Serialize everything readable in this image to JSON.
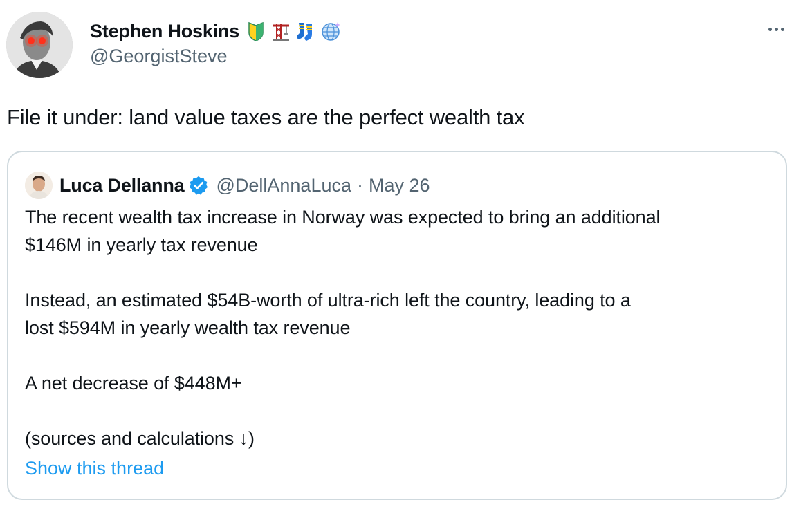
{
  "author": {
    "name": "Stephen Hoskins",
    "handle": "@GeorgistSteve",
    "name_emojis": [
      "beginner-shield-emoji",
      "construction-crane-emoji",
      "socks-emoji",
      "globe-emoji"
    ]
  },
  "tweet": {
    "text": "File it under: land value taxes are the perfect wealth tax"
  },
  "quoted": {
    "name": "Luca Dellanna",
    "handle": "@DellAnnaLuca",
    "separator": "·",
    "date": "May 26",
    "verified_color": "#1d9bf0",
    "paragraphs": [
      "The recent wealth tax increase in Norway was expected to bring an additional",
      "$146M in yearly tax revenue",
      "",
      "Instead, an estimated $54B-worth of ultra-rich left the country, leading to a",
      "lost $594M in yearly wealth tax revenue",
      "",
      "A net decrease of $448M+",
      "",
      "(sources and calculations ↓)"
    ],
    "show_thread_label": "Show this thread"
  },
  "colors": {
    "text": "#0f1419",
    "secondary": "#536471",
    "link": "#1d9bf0",
    "border": "#cfd9de"
  }
}
